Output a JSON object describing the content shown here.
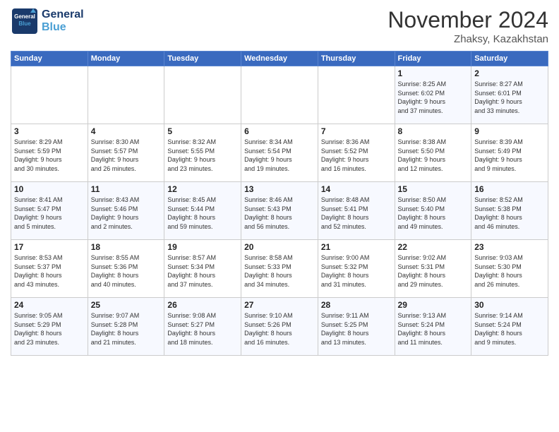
{
  "header": {
    "logo_line1": "General",
    "logo_line2": "Blue",
    "month_title": "November 2024",
    "location": "Zhaksy, Kazakhstan"
  },
  "days_of_week": [
    "Sunday",
    "Monday",
    "Tuesday",
    "Wednesday",
    "Thursday",
    "Friday",
    "Saturday"
  ],
  "weeks": [
    [
      {
        "num": "",
        "info": ""
      },
      {
        "num": "",
        "info": ""
      },
      {
        "num": "",
        "info": ""
      },
      {
        "num": "",
        "info": ""
      },
      {
        "num": "",
        "info": ""
      },
      {
        "num": "1",
        "info": "Sunrise: 8:25 AM\nSunset: 6:02 PM\nDaylight: 9 hours\nand 37 minutes."
      },
      {
        "num": "2",
        "info": "Sunrise: 8:27 AM\nSunset: 6:01 PM\nDaylight: 9 hours\nand 33 minutes."
      }
    ],
    [
      {
        "num": "3",
        "info": "Sunrise: 8:29 AM\nSunset: 5:59 PM\nDaylight: 9 hours\nand 30 minutes."
      },
      {
        "num": "4",
        "info": "Sunrise: 8:30 AM\nSunset: 5:57 PM\nDaylight: 9 hours\nand 26 minutes."
      },
      {
        "num": "5",
        "info": "Sunrise: 8:32 AM\nSunset: 5:55 PM\nDaylight: 9 hours\nand 23 minutes."
      },
      {
        "num": "6",
        "info": "Sunrise: 8:34 AM\nSunset: 5:54 PM\nDaylight: 9 hours\nand 19 minutes."
      },
      {
        "num": "7",
        "info": "Sunrise: 8:36 AM\nSunset: 5:52 PM\nDaylight: 9 hours\nand 16 minutes."
      },
      {
        "num": "8",
        "info": "Sunrise: 8:38 AM\nSunset: 5:50 PM\nDaylight: 9 hours\nand 12 minutes."
      },
      {
        "num": "9",
        "info": "Sunrise: 8:39 AM\nSunset: 5:49 PM\nDaylight: 9 hours\nand 9 minutes."
      }
    ],
    [
      {
        "num": "10",
        "info": "Sunrise: 8:41 AM\nSunset: 5:47 PM\nDaylight: 9 hours\nand 5 minutes."
      },
      {
        "num": "11",
        "info": "Sunrise: 8:43 AM\nSunset: 5:46 PM\nDaylight: 9 hours\nand 2 minutes."
      },
      {
        "num": "12",
        "info": "Sunrise: 8:45 AM\nSunset: 5:44 PM\nDaylight: 8 hours\nand 59 minutes."
      },
      {
        "num": "13",
        "info": "Sunrise: 8:46 AM\nSunset: 5:43 PM\nDaylight: 8 hours\nand 56 minutes."
      },
      {
        "num": "14",
        "info": "Sunrise: 8:48 AM\nSunset: 5:41 PM\nDaylight: 8 hours\nand 52 minutes."
      },
      {
        "num": "15",
        "info": "Sunrise: 8:50 AM\nSunset: 5:40 PM\nDaylight: 8 hours\nand 49 minutes."
      },
      {
        "num": "16",
        "info": "Sunrise: 8:52 AM\nSunset: 5:38 PM\nDaylight: 8 hours\nand 46 minutes."
      }
    ],
    [
      {
        "num": "17",
        "info": "Sunrise: 8:53 AM\nSunset: 5:37 PM\nDaylight: 8 hours\nand 43 minutes."
      },
      {
        "num": "18",
        "info": "Sunrise: 8:55 AM\nSunset: 5:36 PM\nDaylight: 8 hours\nand 40 minutes."
      },
      {
        "num": "19",
        "info": "Sunrise: 8:57 AM\nSunset: 5:34 PM\nDaylight: 8 hours\nand 37 minutes."
      },
      {
        "num": "20",
        "info": "Sunrise: 8:58 AM\nSunset: 5:33 PM\nDaylight: 8 hours\nand 34 minutes."
      },
      {
        "num": "21",
        "info": "Sunrise: 9:00 AM\nSunset: 5:32 PM\nDaylight: 8 hours\nand 31 minutes."
      },
      {
        "num": "22",
        "info": "Sunrise: 9:02 AM\nSunset: 5:31 PM\nDaylight: 8 hours\nand 29 minutes."
      },
      {
        "num": "23",
        "info": "Sunrise: 9:03 AM\nSunset: 5:30 PM\nDaylight: 8 hours\nand 26 minutes."
      }
    ],
    [
      {
        "num": "24",
        "info": "Sunrise: 9:05 AM\nSunset: 5:29 PM\nDaylight: 8 hours\nand 23 minutes."
      },
      {
        "num": "25",
        "info": "Sunrise: 9:07 AM\nSunset: 5:28 PM\nDaylight: 8 hours\nand 21 minutes."
      },
      {
        "num": "26",
        "info": "Sunrise: 9:08 AM\nSunset: 5:27 PM\nDaylight: 8 hours\nand 18 minutes."
      },
      {
        "num": "27",
        "info": "Sunrise: 9:10 AM\nSunset: 5:26 PM\nDaylight: 8 hours\nand 16 minutes."
      },
      {
        "num": "28",
        "info": "Sunrise: 9:11 AM\nSunset: 5:25 PM\nDaylight: 8 hours\nand 13 minutes."
      },
      {
        "num": "29",
        "info": "Sunrise: 9:13 AM\nSunset: 5:24 PM\nDaylight: 8 hours\nand 11 minutes."
      },
      {
        "num": "30",
        "info": "Sunrise: 9:14 AM\nSunset: 5:24 PM\nDaylight: 8 hours\nand 9 minutes."
      }
    ]
  ]
}
